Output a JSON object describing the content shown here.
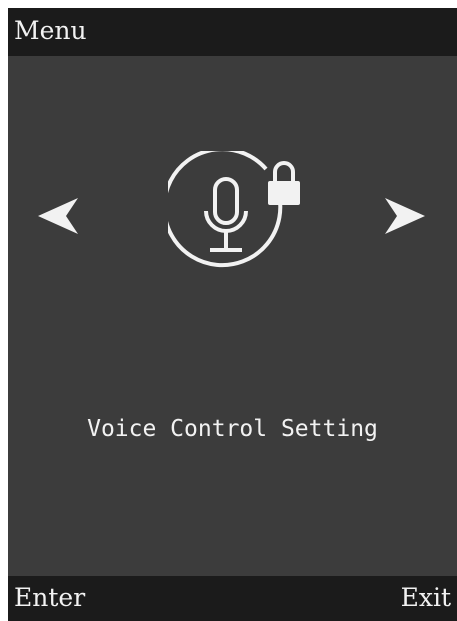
{
  "header": {
    "title": "Menu"
  },
  "main": {
    "prev_icon": "chevron-left-icon",
    "next_icon": "chevron-right-icon",
    "setting_icon": "microphone-lock-icon",
    "label": "Voice Control Setting"
  },
  "footer": {
    "left_softkey": "Enter",
    "right_softkey": "Exit"
  },
  "colors": {
    "background": "#3c3c3c",
    "bar": "#1b1b1b",
    "foreground": "#f2f2f2"
  }
}
